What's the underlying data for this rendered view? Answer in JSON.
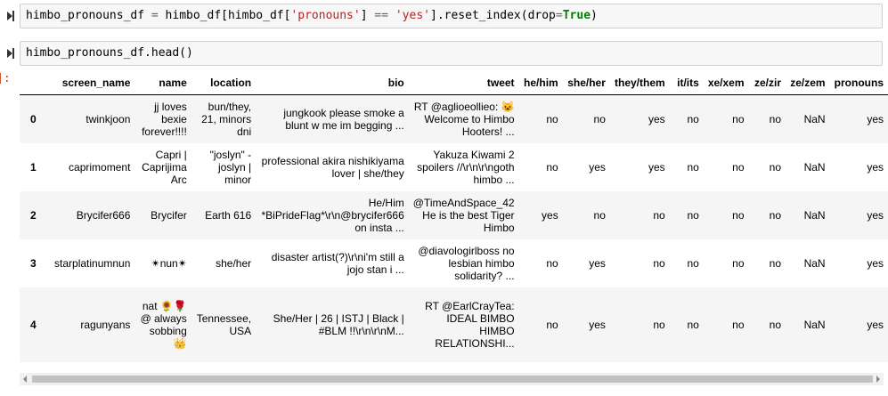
{
  "cells": [
    {
      "code_tokens": [
        {
          "t": "himbo_pronouns_df ",
          "c": ""
        },
        {
          "t": "=",
          "c": "op"
        },
        {
          "t": " himbo_df[himbo_df[",
          "c": ""
        },
        {
          "t": "'pronouns'",
          "c": "str"
        },
        {
          "t": "] ",
          "c": ""
        },
        {
          "t": "==",
          "c": "op"
        },
        {
          "t": " ",
          "c": ""
        },
        {
          "t": "'yes'",
          "c": "str"
        },
        {
          "t": "].reset_index(drop",
          "c": ""
        },
        {
          "t": "=",
          "c": "op"
        },
        {
          "t": "True",
          "c": "kw"
        },
        {
          "t": ")",
          "c": ""
        }
      ]
    },
    {
      "code_tokens": [
        {
          "t": "himbo_pronouns_df.head()",
          "c": ""
        }
      ]
    }
  ],
  "output_prompt": "]:",
  "table": {
    "columns": [
      "",
      "screen_name",
      "name",
      "location",
      "bio",
      "tweet",
      "he/him",
      "she/her",
      "they/them",
      "it/its",
      "xe/xem",
      "ze/zir",
      "ze/zem",
      "pronouns"
    ],
    "rows": [
      {
        "idx": "0",
        "screen_name": "twinkjoon",
        "name": "jj loves bexie forever!!!!",
        "location": "bun/they, 21, minors dni",
        "bio": "jungkook please smoke a blunt w me im begging ...",
        "tweet": "RT @aglioeollieo: 😺 Welcome to Himbo Hooters! ...",
        "he_him": "no",
        "she_her": "no",
        "they_them": "yes",
        "it_its": "no",
        "xe_xem": "no",
        "ze_zir": "no",
        "ze_zem": "NaN",
        "pronouns": "yes"
      },
      {
        "idx": "1",
        "screen_name": "caprimoment",
        "name": "Capri | Caprijima Arc",
        "location": "\"joslyn\" - joslyn | minor",
        "bio": "professional akira nishikiyama lover | she/they",
        "tweet": "Yakuza Kiwami 2 spoilers //\\r\\n\\r\\ngoth himbo ...",
        "he_him": "no",
        "she_her": "yes",
        "they_them": "yes",
        "it_its": "no",
        "xe_xem": "no",
        "ze_zir": "no",
        "ze_zem": "NaN",
        "pronouns": "yes"
      },
      {
        "idx": "2",
        "screen_name": "Brycifer666",
        "name": "Brycifer",
        "location": "Earth 616",
        "bio": "He/Him *BiPrideFlag*\\r\\n@brycifer666 on insta ...",
        "tweet": "@TimeAndSpace_42 He is the best Tiger Himbo",
        "he_him": "yes",
        "she_her": "no",
        "they_them": "no",
        "it_its": "no",
        "xe_xem": "no",
        "ze_zir": "no",
        "ze_zem": "NaN",
        "pronouns": "yes"
      },
      {
        "idx": "3",
        "screen_name": "starplatinumnun",
        "name": "✴nun✴",
        "location": "she/her",
        "bio": "disaster artist(?)\\r\\ni'm still a jojo stan i ...",
        "tweet": "@diavologirlboss no lesbian himbo solidarity? ...",
        "he_him": "no",
        "she_her": "yes",
        "they_them": "no",
        "it_its": "no",
        "xe_xem": "no",
        "ze_zir": "no",
        "ze_zem": "NaN",
        "pronouns": "yes"
      },
      {
        "idx": "4",
        "screen_name": "ragunyans",
        "name": "nat 🌻🌹 @ always sobbing 👑",
        "location": "Tennessee, USA",
        "bio": "She/Her | 26 | ISTJ | Black | #BLM !!\\r\\n\\r\\nM...",
        "tweet": "RT @EarlCrayTea: IDEAL BIMBO HIMBO RELATIONSHI...",
        "he_him": "no",
        "she_her": "yes",
        "they_them": "no",
        "it_its": "no",
        "xe_xem": "no",
        "ze_zir": "no",
        "ze_zem": "NaN",
        "pronouns": "yes"
      }
    ]
  },
  "icons": {
    "run": "run-cell-icon",
    "scroll_left": "scroll-left-arrow-icon",
    "scroll_right": "scroll-right-arrow-icon"
  },
  "colors": {
    "string": "#ba2121",
    "keyword": "#008000",
    "prompt": "#d84315",
    "code_bg": "#f7f7f7"
  }
}
